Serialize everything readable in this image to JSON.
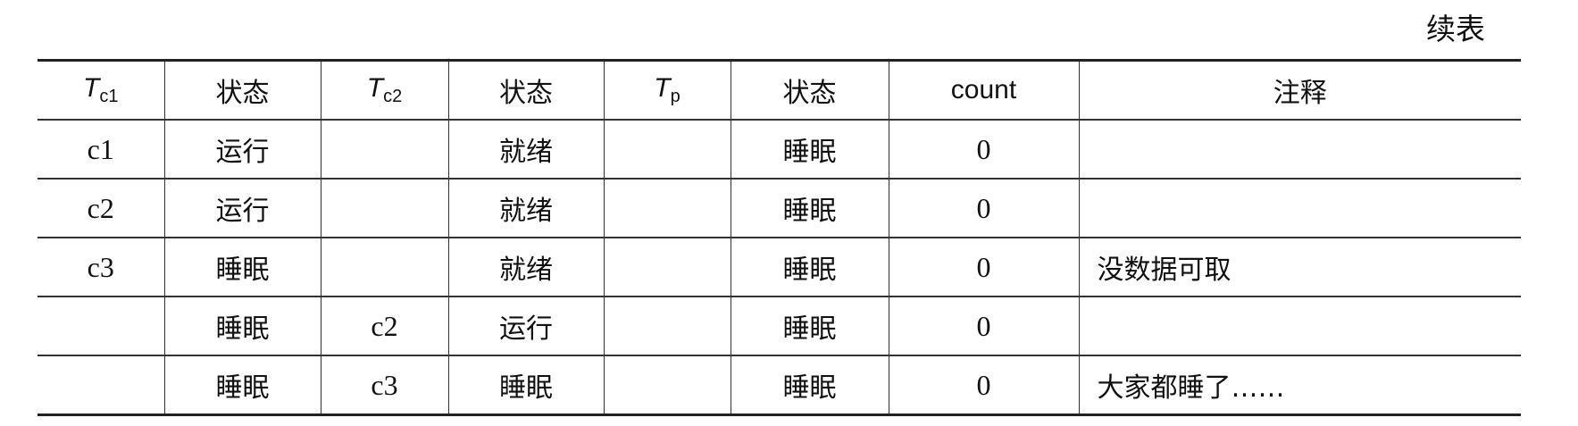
{
  "caption": "续表",
  "headers": [
    {
      "main": "T",
      "sub": "c1"
    },
    {
      "main": "状态"
    },
    {
      "main": "T",
      "sub": "c2"
    },
    {
      "main": "状态"
    },
    {
      "main": "T",
      "sub": "p"
    },
    {
      "main": "状态"
    },
    {
      "main": "count"
    },
    {
      "main": "注释"
    }
  ],
  "rows": [
    [
      "c1",
      "运行",
      "",
      "就绪",
      "",
      "睡眠",
      "0",
      ""
    ],
    [
      "c2",
      "运行",
      "",
      "就绪",
      "",
      "睡眠",
      "0",
      ""
    ],
    [
      "c3",
      "睡眠",
      "",
      "就绪",
      "",
      "睡眠",
      "0",
      "没数据可取"
    ],
    [
      "",
      "睡眠",
      "c2",
      "运行",
      "",
      "睡眠",
      "0",
      ""
    ],
    [
      "",
      "睡眠",
      "c3",
      "睡眠",
      "",
      "睡眠",
      "0",
      "大家都睡了……"
    ]
  ]
}
